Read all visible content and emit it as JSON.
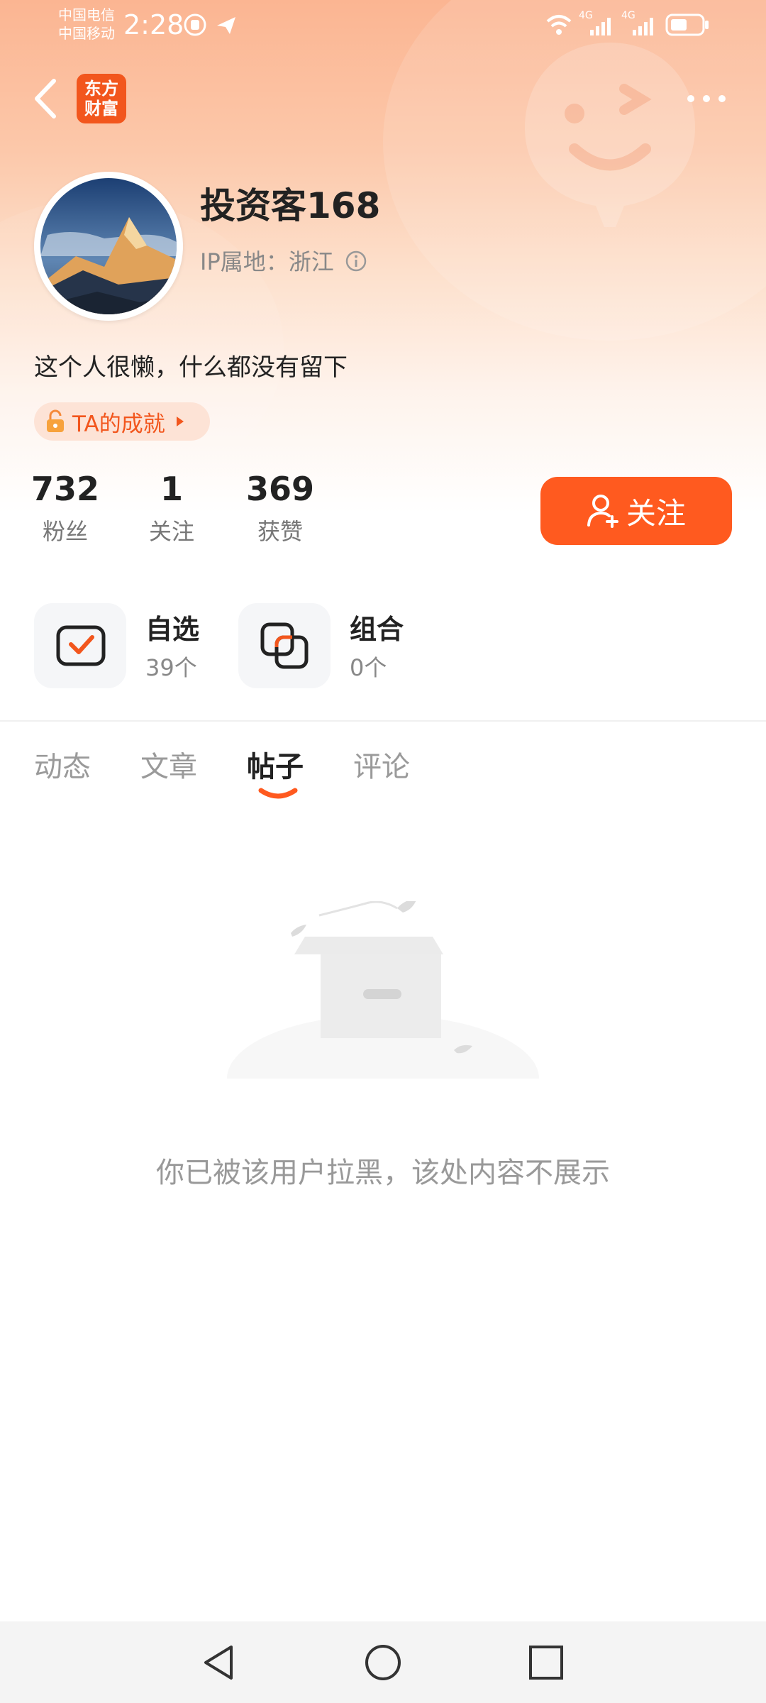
{
  "status_bar": {
    "carrier1": "中国电信",
    "carrier2": "中国移动",
    "time": "2:28",
    "signal1": "4G",
    "signal2": "4G"
  },
  "header": {
    "logo_line1": "东方",
    "logo_line2": "财富"
  },
  "profile": {
    "username": "投资客168",
    "ip_location": "IP属地：浙江",
    "bio": "这个人很懒，什么都没有留下",
    "achievements_label": "TA的成就"
  },
  "stats": [
    {
      "value": "732",
      "label": "粉丝"
    },
    {
      "value": "1",
      "label": "关注"
    },
    {
      "value": "369",
      "label": "获赞"
    }
  ],
  "follow_button": "关注",
  "shortcuts": [
    {
      "title": "自选",
      "count": "39个"
    },
    {
      "title": "组合",
      "count": "0个"
    }
  ],
  "tabs": [
    {
      "label": "动态"
    },
    {
      "label": "文章"
    },
    {
      "label": "帖子",
      "active": true
    },
    {
      "label": "评论"
    }
  ],
  "empty_message": "你已被该用户拉黑，该处内容不展示",
  "colors": {
    "accent": "#ff5a1f",
    "brand": "#f2561d"
  }
}
